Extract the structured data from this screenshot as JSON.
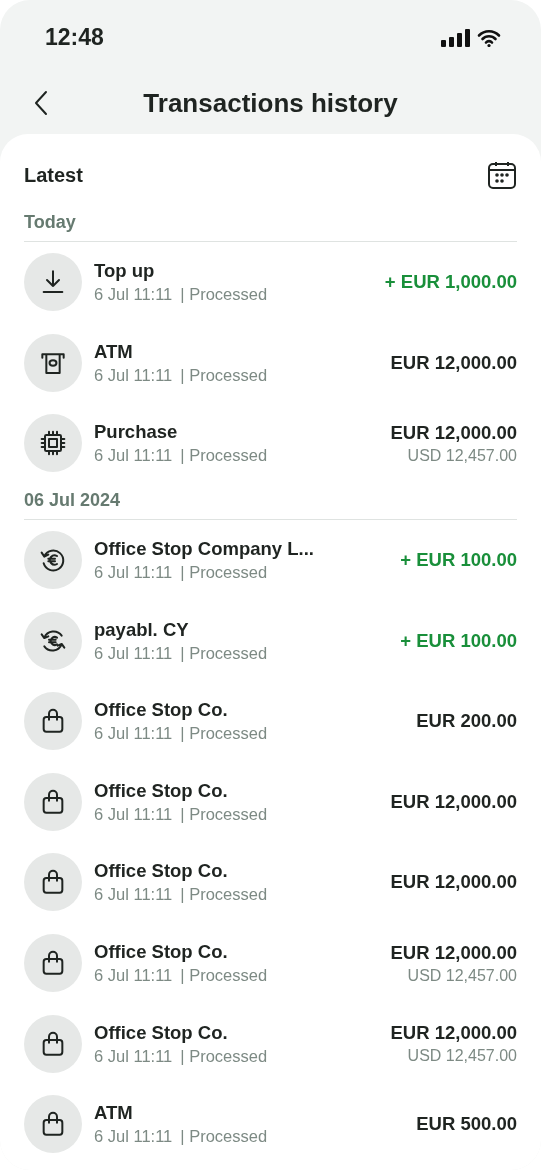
{
  "status_bar": {
    "time": "12:48"
  },
  "header": {
    "title": "Transactions history"
  },
  "section": {
    "title": "Latest"
  },
  "groups": [
    {
      "label": "Today",
      "transactions": [
        {
          "kind": "download",
          "title": "Top up",
          "date": "6 Jul 11:11",
          "status": "| Processed",
          "amount": "+ EUR 1,000.00",
          "incoming": true
        },
        {
          "kind": "atm",
          "title": "ATM",
          "date": "6 Jul 11:11",
          "status": "| Processed",
          "amount": "EUR 12,000.00",
          "incoming": false
        },
        {
          "kind": "chip",
          "title": "Purchase",
          "date": "6 Jul 11:11",
          "status": "| Processed",
          "amount": "EUR 12,000.00",
          "secondary_amount": "USD 12,457.00",
          "incoming": false
        }
      ]
    },
    {
      "label": "06 Jul 2024",
      "transactions": [
        {
          "kind": "refund",
          "title": "Office Stop Company L...",
          "date": "6 Jul 11:11",
          "status": "| Processed",
          "amount": "+ EUR 100.00",
          "incoming": true
        },
        {
          "kind": "exchange",
          "title": "payabl. CY",
          "date": "6 Jul 11:11",
          "status": "| Processed",
          "amount": "+ EUR 100.00",
          "incoming": true
        },
        {
          "kind": "shop",
          "title": "Office Stop Co.",
          "date": "6 Jul 11:11",
          "status": "| Processed",
          "amount": "EUR 200.00",
          "incoming": false
        },
        {
          "kind": "shop",
          "title": "Office Stop Co.",
          "date": "6 Jul 11:11",
          "status": "| Processed",
          "amount": "EUR 12,000.00",
          "incoming": false
        },
        {
          "kind": "shop",
          "title": "Office Stop Co.",
          "date": "6 Jul 11:11",
          "status": "| Processed",
          "amount": "EUR 12,000.00",
          "incoming": false
        },
        {
          "kind": "shop",
          "title": "Office Stop Co.",
          "date": "6 Jul 11:11",
          "status": "| Processed",
          "amount": "EUR 12,000.00",
          "secondary_amount": "USD 12,457.00",
          "incoming": false
        },
        {
          "kind": "shop",
          "title": "Office Stop Co.",
          "date": "6 Jul 11:11",
          "status": "| Processed",
          "amount": "EUR 12,000.00",
          "secondary_amount": "USD 12,457.00",
          "incoming": false
        },
        {
          "kind": "shop",
          "title": "ATM",
          "date": "6 Jul 11:11",
          "status": "| Processed",
          "amount": "EUR 500.00",
          "incoming": false
        }
      ]
    }
  ]
}
